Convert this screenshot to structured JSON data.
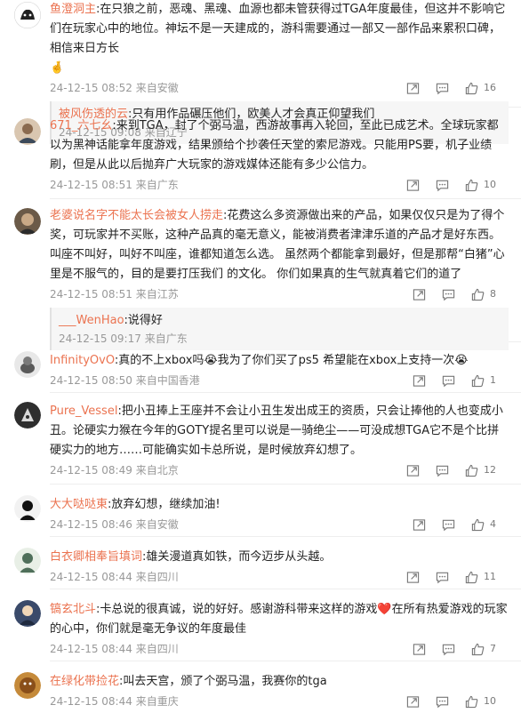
{
  "comments": [
    {
      "user": "鱼澄洞主",
      "text": "在只狼之前，恶魂、黑魂、血源也都未管获得过TGA年度最佳，但这并不影响它们在玩家心中的地位。神坛不是一天建成的，游科需要通过一部又一部作品来累积口碑，相信来日方长",
      "emoji": "🤞",
      "time": "24-12-15 08:52",
      "location": "来自安徽",
      "likes": "16",
      "reply": {
        "user": "被风伤透的云",
        "text": "只有用作品碾压他们，欧美人才会真正仰望我们",
        "time": "24-12-15 09:08",
        "location": "来自辽宁"
      }
    },
    {
      "user": "671_六七幺",
      "text": "来到TGA，封了个弼马温，西游故事再入轮回，至此已成艺术。全球玩家都以为黑神话能拿年度游戏，结果颁给个抄袭任天堂的索尼游戏。只能用PS要，机子业绩刷，但是从此以后抛弃广大玩家的游戏媒体还能有多少公信力。",
      "time": "24-12-15 08:51",
      "location": "来自广东",
      "likes": "10"
    },
    {
      "user": "老婆说名字不能太长会被女人捞走",
      "text": "花费这么多资源做出来的产品，如果仅仅只是为了得个奖，可玩家并不买账，这种产品真的毫无意义，能被消费者津津乐道的产品才是好东西。 叫座不叫好，叫好不叫座，谁都知道怎么选。 虽然两个都能拿到最好，但是那帮“白猪”心里是不服气的，目的是要打压我们 的文化。 你们如果真的生气就真着它们的道了",
      "time": "24-12-15 08:51",
      "location": "来自江苏",
      "likes": "8",
      "reply": {
        "user": "___WenHao",
        "text": "说得好",
        "time": "24-12-15 09:17",
        "location": "来自广东"
      }
    },
    {
      "user": "InfinityOvO",
      "text": "真的不上xbox吗",
      "emoji": "😭",
      "text2": "我为了你们买了ps5 希望能在xbox上支持一次",
      "emoji2": "😭",
      "time": "24-12-15 08:50",
      "location": "来自中国香港",
      "likes": "1"
    },
    {
      "user": "Pure_Vessel",
      "text": "把小丑捧上王座并不会让小丑生发出成王的资质，只会让捧他的人也变成小丑。论硬实力猴在今年的GOTY提名里可以说是一骑绝尘——可没成想TGA它不是个比拼硬实力的地方……可能确实如卡总所说，是时候放弃幻想了。",
      "time": "24-12-15 08:49",
      "location": "来自北京",
      "likes": "12"
    },
    {
      "user": "大大哒哒東",
      "text": "放弃幻想，继续加油!",
      "time": "24-12-15 08:46",
      "location": "来自安徽",
      "likes": "4"
    },
    {
      "user": "白衣卿相奉旨填词",
      "text": "雄关漫道真如铁，而今迈步从头越。",
      "time": "24-12-15 08:44",
      "location": "来自四川",
      "likes": "11"
    },
    {
      "user": "镐玄北斗",
      "text": "卡总说的很真诚，说的好好。感谢游科带来这样的游戏",
      "emoji": "❤️",
      "text2": "在所有热爱游戏的玩家的心中，你们就是毫无争议的年度最佳",
      "time": "24-12-15 08:44",
      "location": "来自四川",
      "likes": "7"
    },
    {
      "user": "在绿化带捡花",
      "text": "叫去天宫，颁了个弼马温，我赛你的tga",
      "time": "24-12-15 08:44",
      "location": "来自重庆",
      "likes": "10"
    }
  ],
  "colors": {
    "username": "#eb7350",
    "meta": "#999999",
    "text": "#222222",
    "reply_bg": "#f6f6f6"
  }
}
